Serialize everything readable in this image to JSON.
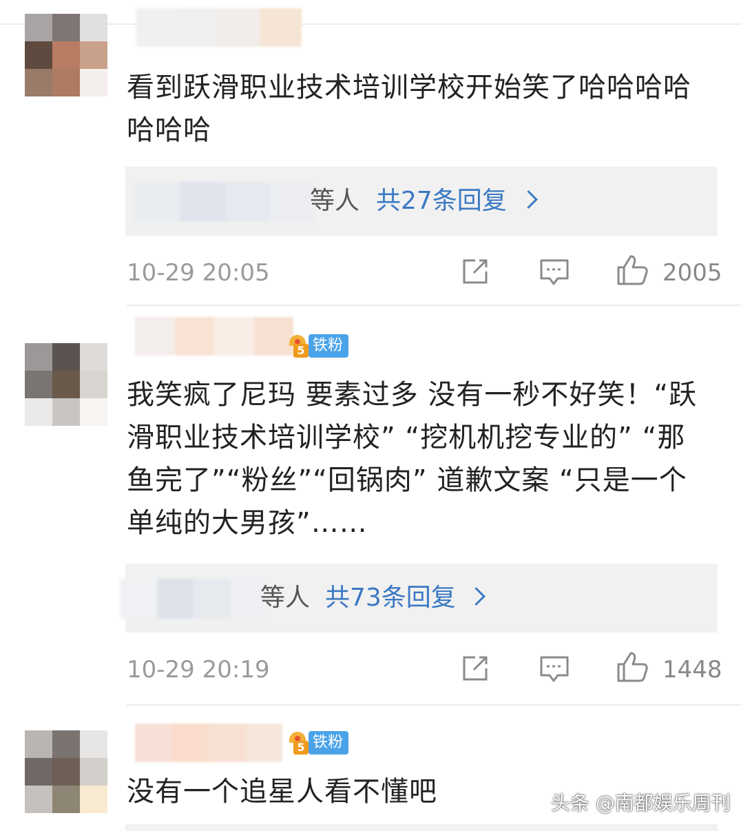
{
  "comments": [
    {
      "text": "看到跃滑职业技术培训学校开始笑了哈哈哈哈哈哈哈",
      "reply_others": "等人",
      "reply_count": "共27条回复",
      "time": "10-29 20:05",
      "likes": "2005"
    },
    {
      "badge": "铁粉",
      "badge_level": "5",
      "text": "我笑疯了尼玛 要素过多 没有一秒不好笑！“跃滑职业技术培训学校” “挖机机挖专业的” “那鱼完了”“粉丝”“回锅肉” 道歉文案 “只是一个单纯的大男孩”……",
      "reply_others": "等人",
      "reply_count": "共73条回复",
      "time": "10-29 20:19",
      "likes": "1448"
    },
    {
      "badge": "铁粉",
      "badge_level": "5",
      "text": "没有一个追星人看不懂吧"
    }
  ],
  "watermark": "头条 @南都娱乐周刊",
  "icons": [
    "repost-icon",
    "comment-icon",
    "like-icon"
  ],
  "colors": {
    "link": "#3b79c4",
    "badge": "#4aa3e8",
    "meta": "#9a9a9a"
  }
}
